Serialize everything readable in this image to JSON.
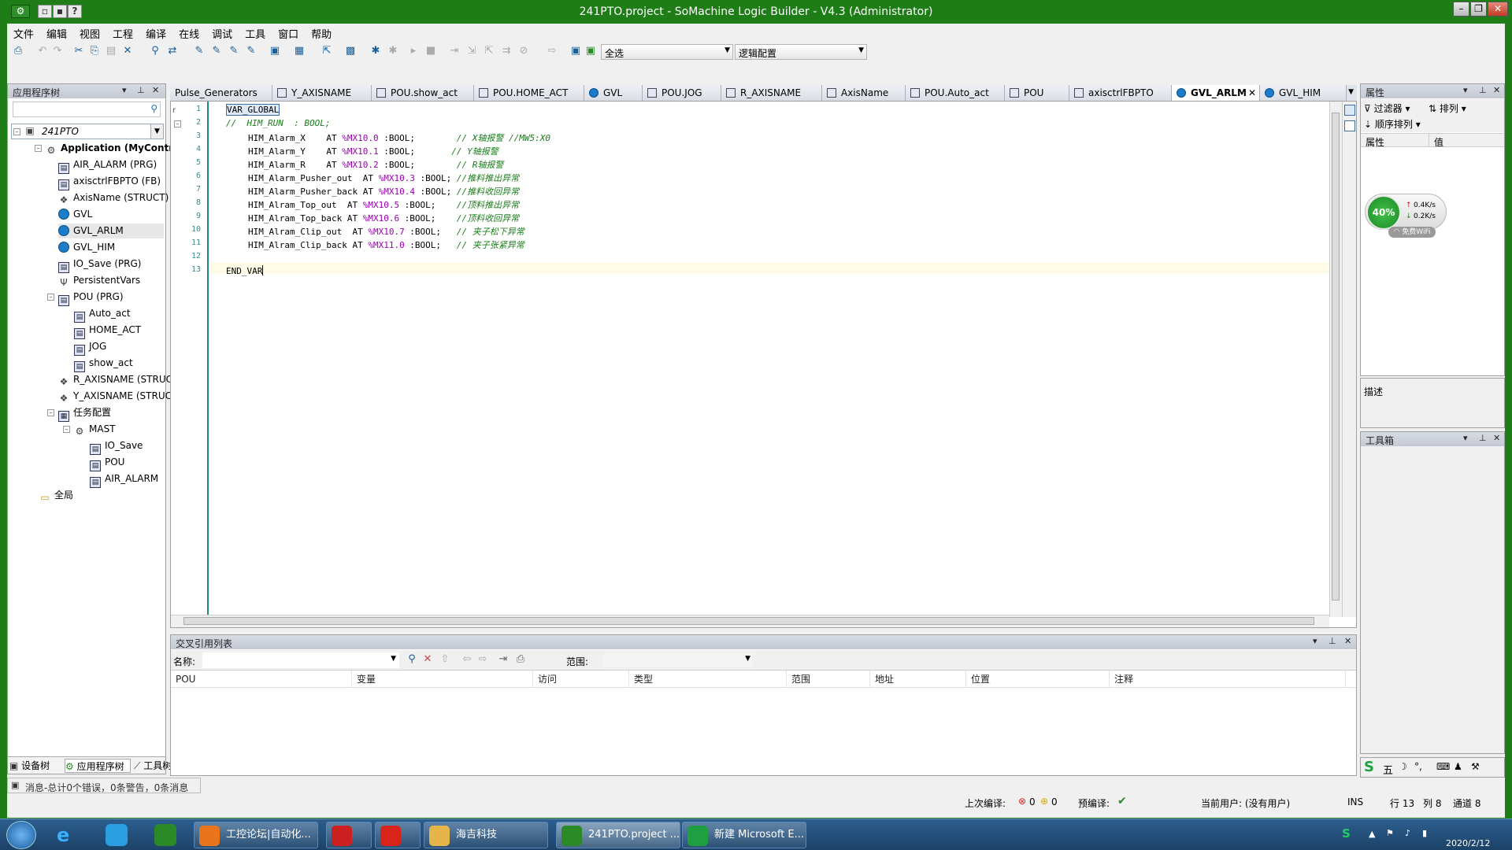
{
  "window": {
    "title": "241PTO.project - SoMachine Logic Builder - V4.3 (Administrator)"
  },
  "menu": [
    "文件",
    "编辑",
    "视图",
    "工程",
    "编译",
    "在线",
    "调试",
    "工具",
    "窗口",
    "帮助"
  ],
  "toolbar": {
    "select_combo": "全选",
    "config_combo": "逻辑配置"
  },
  "app_tree": {
    "title": "应用程序树",
    "root": "241PTO",
    "rows": [
      {
        "label": "Application (MyController",
        "icon": "gear",
        "bold": true
      },
      {
        "label": "AIR_ALARM (PRG)",
        "icon": "prg"
      },
      {
        "label": "axisctrlFBPTO (FB)",
        "icon": "prg"
      },
      {
        "label": "AxisName (STRUCT)",
        "icon": "struct"
      },
      {
        "label": "GVL",
        "icon": "gvl"
      },
      {
        "label": "GVL_ARLM",
        "icon": "gvl",
        "selected": true
      },
      {
        "label": "GVL_HIM",
        "icon": "gvl"
      },
      {
        "label": "IO_Save (PRG)",
        "icon": "prg"
      },
      {
        "label": "PersistentVars",
        "icon": "pers"
      },
      {
        "label": "POU (PRG)",
        "icon": "prg"
      },
      {
        "label": "Auto_act",
        "icon": "act"
      },
      {
        "label": "HOME_ACT",
        "icon": "act"
      },
      {
        "label": "JOG",
        "icon": "act"
      },
      {
        "label": "show_act",
        "icon": "act"
      },
      {
        "label": "R_AXISNAME (STRUCT)",
        "icon": "struct"
      },
      {
        "label": "Y_AXISNAME (STRUCT)",
        "icon": "struct"
      },
      {
        "label": "任务配置",
        "icon": "task"
      },
      {
        "label": "MAST",
        "icon": "mast"
      },
      {
        "label": "IO_Save",
        "icon": "call"
      },
      {
        "label": "POU",
        "icon": "call"
      },
      {
        "label": "AIR_ALARM",
        "icon": "call"
      },
      {
        "label": "全局",
        "icon": "folder"
      }
    ],
    "bottom_tabs": [
      "设备树",
      "应用程序树",
      "工具树"
    ]
  },
  "editor_tabs": [
    {
      "label": "Pulse_Generators",
      "icon": "none"
    },
    {
      "label": "Y_AXISNAME",
      "icon": "struct"
    },
    {
      "label": "POU.show_act",
      "icon": "prg"
    },
    {
      "label": "POU.HOME_ACT",
      "icon": "prg"
    },
    {
      "label": "GVL",
      "icon": "gvl"
    },
    {
      "label": "POU.JOG",
      "icon": "prg"
    },
    {
      "label": "R_AXISNAME",
      "icon": "struct"
    },
    {
      "label": "AxisName",
      "icon": "struct"
    },
    {
      "label": "POU.Auto_act",
      "icon": "prg"
    },
    {
      "label": "POU",
      "icon": "prg"
    },
    {
      "label": "axisctrlFBPTO",
      "icon": "prg"
    },
    {
      "label": "GVL_ARLM",
      "icon": "gvl",
      "active": true
    },
    {
      "label": "GVL_HIM",
      "icon": "gvl"
    }
  ],
  "code": {
    "line_numbers": [
      "1",
      "2",
      "3",
      "4",
      "5",
      "6",
      "7",
      "8",
      "9",
      "10",
      "11",
      "12",
      "13"
    ],
    "lines": [
      {
        "t": "VAR_GLOBAL"
      },
      {
        "t": "//  HIM_RUN  : BOOL;"
      },
      {
        "v": "HIM_Alarm_X    AT ",
        "a": "%MX10.0",
        "r": " :BOOL;",
        "c": "        // X轴报警 //MW5:X0"
      },
      {
        "v": "HIM_Alarm_Y    AT ",
        "a": "%MX10.1",
        "r": " :BOOL;",
        "c": "       // Y轴报警"
      },
      {
        "v": "HIM_Alarm_R    AT ",
        "a": "%MX10.2",
        "r": " :BOOL;",
        "c": "        // R轴报警"
      },
      {
        "v": "HIM_Alarm_Pusher_out  AT ",
        "a": "%MX10.3",
        "r": " :BOOL;",
        "c": " //推料推出异常"
      },
      {
        "v": "HIM_Alarm_Pusher_back AT ",
        "a": "%MX10.4",
        "r": " :BOOL;",
        "c": " //推料收回异常"
      },
      {
        "v": "HIM_Alram_Top_out  AT ",
        "a": "%MX10.5",
        "r": " :BOOL;",
        "c": "    //顶料推出异常"
      },
      {
        "v": "HIM_Alram_Top_back AT ",
        "a": "%MX10.6",
        "r": " :BOOL;",
        "c": "    //顶料收回异常"
      },
      {
        "v": "HIM_Alram_Clip_out  AT ",
        "a": "%MX10.7",
        "r": " :BOOL;",
        "c": "   // 夹子松下异常"
      },
      {
        "v": "HIM_Alram_Clip_back AT ",
        "a": "%MX11.0",
        "r": " :BOOL;",
        "c": "   // 夹子张紧异常"
      },
      {
        "t": ""
      },
      {
        "t": "END_VAR"
      }
    ],
    "fold_marker": "r"
  },
  "xref": {
    "title": "交叉引用列表",
    "name_label": "名称:",
    "scope_label": "范围:",
    "columns": [
      "POU",
      "变量",
      "访问",
      "类型",
      "范围",
      "地址",
      "位置",
      "注释"
    ]
  },
  "properties": {
    "title": "属性",
    "filter": "过滤器",
    "sort": "排列",
    "order": "顺序排列",
    "col_prop": "属性",
    "col_val": "值",
    "desc": "描述"
  },
  "network_widget": {
    "percent": "40%",
    "up": "0.4K/s",
    "down": "0.2K/s",
    "label": "免费WiFi"
  },
  "toolbox": {
    "title": "工具箱"
  },
  "messages": {
    "text": "消息-总计0个错误，0条警告，0条消息"
  },
  "status": {
    "last_build": "上次编译:",
    "err": "0",
    "warn": "0",
    "precompile": "预编译:",
    "user": "当前用户: (没有用户)",
    "ins": "INS",
    "line": "行 13",
    "col": "列 8",
    "ch": "通道 8"
  },
  "taskbar": {
    "items": [
      {
        "label": "工控论坛|自动化...",
        "color": "#e8741c"
      },
      {
        "label": "",
        "color": "#cc2020"
      },
      {
        "label": "",
        "color": "#d9241c"
      },
      {
        "label": "海吉科技",
        "color": "#e4b54a"
      },
      {
        "label": "241PTO.project ...",
        "color": "#2a8a28",
        "active": true
      },
      {
        "label": "新建 Microsoft E...",
        "color": "#1fa040"
      }
    ],
    "ime": "五",
    "date": "2020/2/12"
  }
}
